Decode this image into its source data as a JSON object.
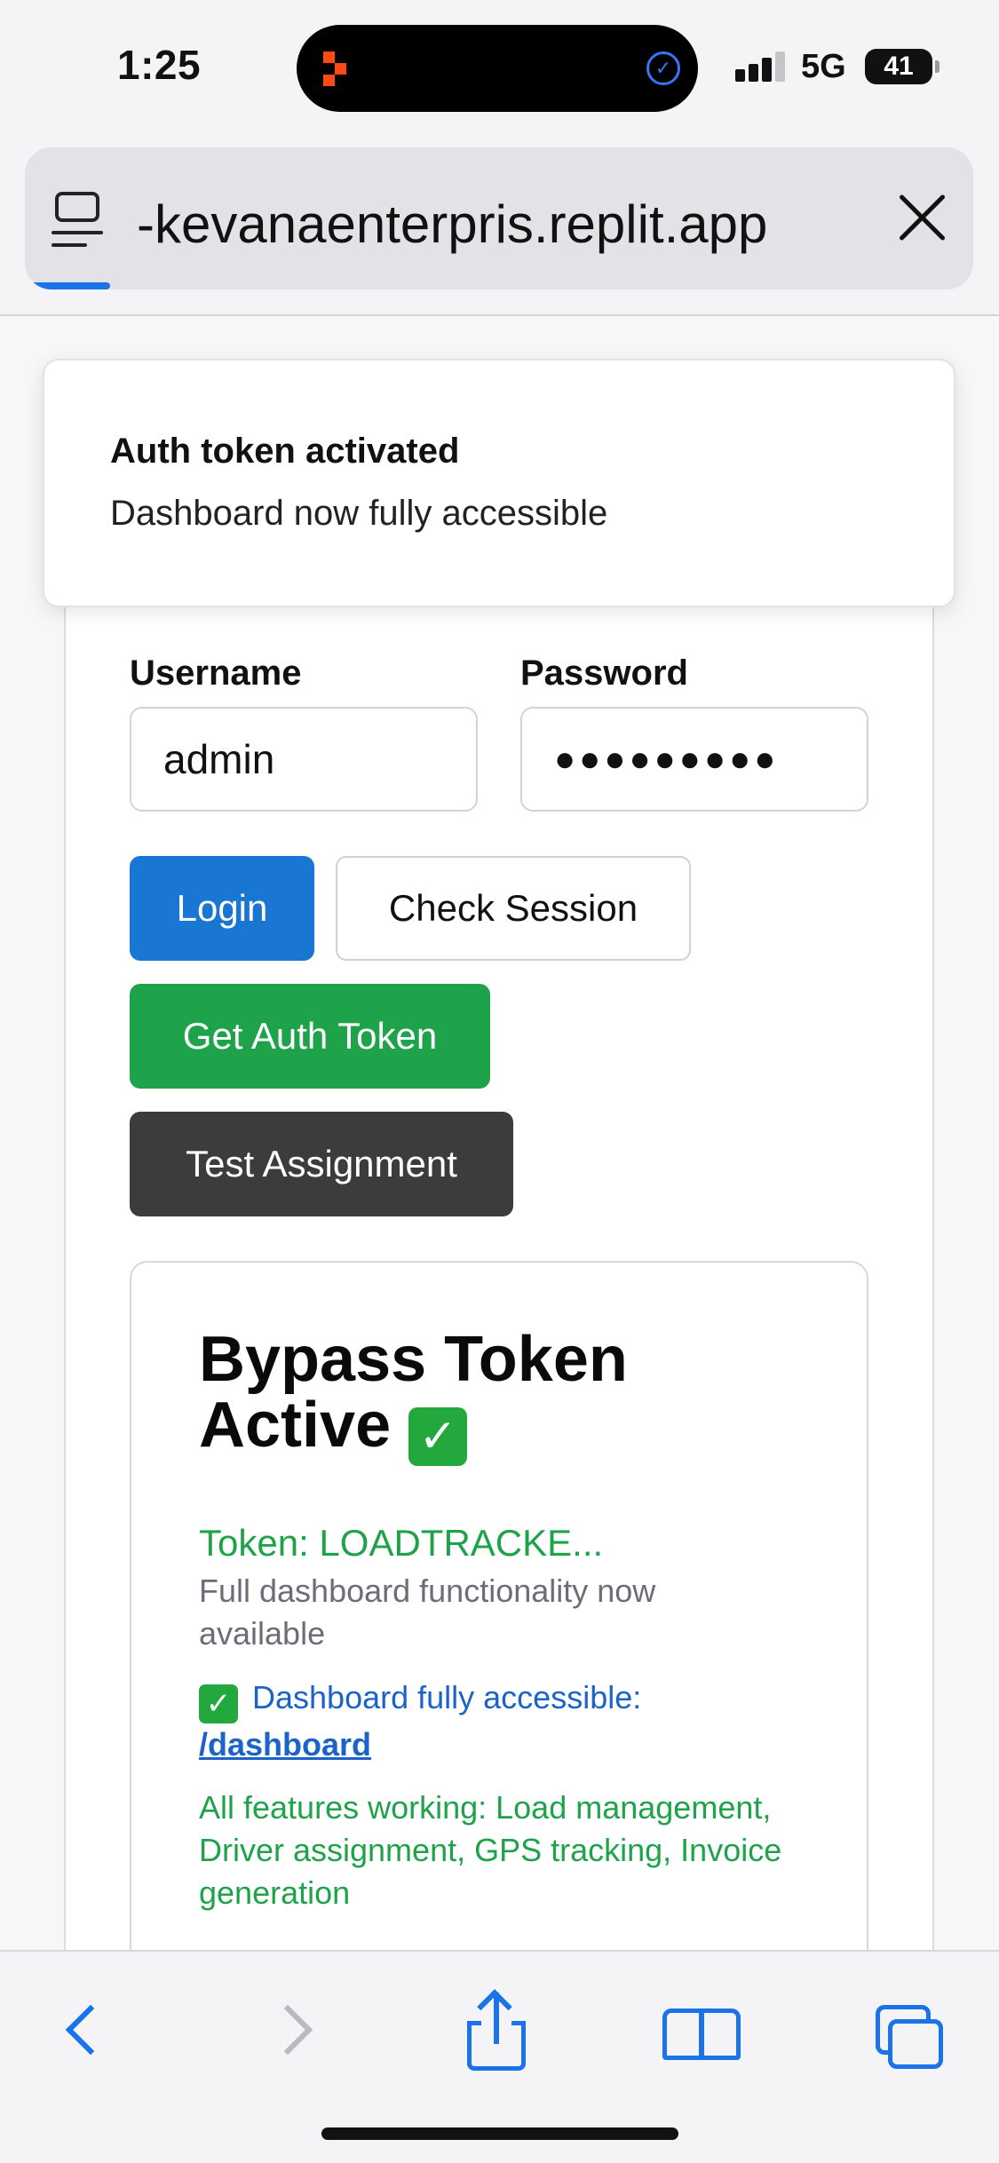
{
  "status_bar": {
    "time": "1:25",
    "network": "5G",
    "battery": "41"
  },
  "browser": {
    "url": "-kevanaenterpris.replit.app",
    "load_progress_percent": 9
  },
  "toast": {
    "title": "Auth token activated",
    "description": "Dashboard now fully accessible"
  },
  "login_form": {
    "username_label": "Username",
    "username_value": "admin",
    "password_label": "Password",
    "password_value": "●●●●●●●●●"
  },
  "buttons": {
    "login": "Login",
    "check_session": "Check Session",
    "get_auth_token": "Get Auth Token",
    "test_assignment": "Test Assignment"
  },
  "result": {
    "title": "Bypass Token Active",
    "title_emoji": "✓",
    "token": "Token: LOADTRACKE...",
    "token_note": "Full dashboard functionality now available",
    "dashboard_prefix_emoji": "✓",
    "dashboard_text": "Dashboard fully accessible:",
    "dashboard_link": "/dashboard",
    "features": "All features working: Load management, Driver assignment, GPS tracking, Invoice generation"
  },
  "colors": {
    "primary": "#1976d2",
    "success": "#1ea34a",
    "dark_button": "#3c3c3e",
    "link": "#1b63c8",
    "ios_blue": "#1a73e8"
  },
  "icons": [
    "tabs-icon",
    "close-icon",
    "back-icon",
    "forward-icon",
    "share-icon",
    "bookmarks-icon",
    "tab-switcher-icon"
  ]
}
